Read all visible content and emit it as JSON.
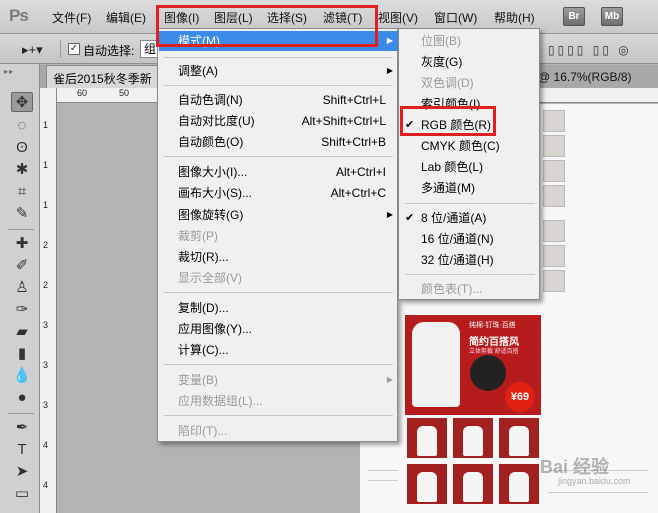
{
  "app": {
    "logo": "Ps"
  },
  "menubar": {
    "items": [
      "文件(F)",
      "编辑(E)",
      "图像(I)",
      "图层(L)",
      "选择(S)",
      "滤镜(T)",
      "视图(V)",
      "窗口(W)",
      "帮助(H)"
    ],
    "bridge": "Br",
    "minibridge": "Mb"
  },
  "options": {
    "tool_glyph": "▸+▾",
    "auto_select_label": "自动选择:",
    "auto_select_value": "组",
    "checked": "✓"
  },
  "document": {
    "tab_title": "雀后2015秋冬季新",
    "tab_right": "@ 16.7%(RGB/8)",
    "close_glyph": "×"
  },
  "ruler": {
    "top_numbers": [
      "60",
      "50",
      "40"
    ],
    "left_numbers": [
      "1",
      "1",
      "1",
      "2",
      "2",
      "3",
      "3",
      "3",
      "4",
      "4"
    ]
  },
  "image_menu": {
    "items": [
      {
        "label": "模式(M)",
        "shortcut": "",
        "submenu": true,
        "highlighted": true,
        "disabled": false
      },
      {
        "label": "调整(A)",
        "shortcut": "",
        "submenu": true,
        "highlighted": false,
        "disabled": false
      },
      {
        "label": "自动色调(N)",
        "shortcut": "Shift+Ctrl+L",
        "submenu": false,
        "disabled": false
      },
      {
        "label": "自动对比度(U)",
        "shortcut": "Alt+Shift+Ctrl+L",
        "submenu": false,
        "disabled": false
      },
      {
        "label": "自动颜色(O)",
        "shortcut": "Shift+Ctrl+B",
        "submenu": false,
        "disabled": false
      },
      {
        "label": "图像大小(I)...",
        "shortcut": "Alt+Ctrl+I",
        "submenu": false,
        "disabled": false
      },
      {
        "label": "画布大小(S)...",
        "shortcut": "Alt+Ctrl+C",
        "submenu": false,
        "disabled": false
      },
      {
        "label": "图像旋转(G)",
        "shortcut": "",
        "submenu": true,
        "disabled": false
      },
      {
        "label": "裁剪(P)",
        "shortcut": "",
        "submenu": false,
        "disabled": true
      },
      {
        "label": "裁切(R)...",
        "shortcut": "",
        "submenu": false,
        "disabled": false
      },
      {
        "label": "显示全部(V)",
        "shortcut": "",
        "submenu": false,
        "disabled": true
      },
      {
        "label": "复制(D)...",
        "shortcut": "",
        "submenu": false,
        "disabled": false
      },
      {
        "label": "应用图像(Y)...",
        "shortcut": "",
        "submenu": false,
        "disabled": false
      },
      {
        "label": "计算(C)...",
        "shortcut": "",
        "submenu": false,
        "disabled": false
      },
      {
        "label": "变量(B)",
        "shortcut": "",
        "submenu": true,
        "disabled": true
      },
      {
        "label": "应用数据组(L)...",
        "shortcut": "",
        "submenu": false,
        "disabled": true
      },
      {
        "label": "陷印(T)...",
        "shortcut": "",
        "submenu": false,
        "disabled": true
      }
    ],
    "arrow": "▶"
  },
  "mode_submenu": {
    "items": [
      {
        "label": "位图(B)",
        "checked": false,
        "disabled": true
      },
      {
        "label": "灰度(G)",
        "checked": false,
        "disabled": false
      },
      {
        "label": "双色调(D)",
        "checked": false,
        "disabled": true
      },
      {
        "label": "索引颜色(I)",
        "checked": false,
        "disabled": false
      },
      {
        "label": "RGB 颜色(R)",
        "checked": true,
        "disabled": false
      },
      {
        "label": "CMYK 颜色(C)",
        "checked": false,
        "disabled": false
      },
      {
        "label": "Lab 颜色(L)",
        "checked": false,
        "disabled": false
      },
      {
        "label": "多通道(M)",
        "checked": false,
        "disabled": false
      },
      {
        "label": "8 位/通道(A)",
        "checked": true,
        "disabled": false
      },
      {
        "label": "16 位/通道(N)",
        "checked": false,
        "disabled": false
      },
      {
        "label": "32 位/通道(H)",
        "checked": false,
        "disabled": false
      },
      {
        "label": "颜色表(T)...",
        "checked": false,
        "disabled": true
      }
    ],
    "check_glyph": "✔"
  },
  "canvas": {
    "promo_title": "简约百搭风",
    "promo_tags": "纯棉·钉珠·百搭",
    "promo_sub": "立体剪裁 舒适百搭",
    "promo_price": "¥69"
  },
  "watermark": {
    "text": "Bai 经验",
    "sub": "jingyan.baidu.com"
  },
  "colors": {
    "highlight": "#3c8ae8",
    "annotation_red": "#e02020",
    "promo_red": "#b71c1c"
  }
}
